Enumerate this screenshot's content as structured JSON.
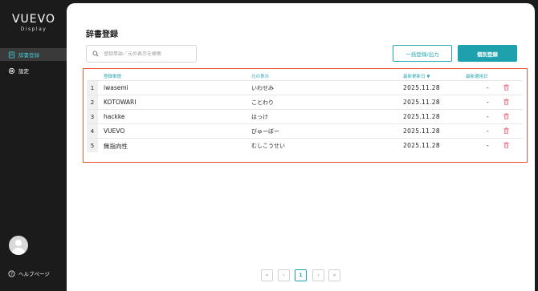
{
  "sidebar": {
    "logo_main": "VUEVO",
    "logo_sub": "Display",
    "items": [
      {
        "label": "辞書登録",
        "icon": "dictionary-icon",
        "active": true
      },
      {
        "label": "設定",
        "icon": "gear-icon",
        "active": false
      }
    ],
    "help_label": "ヘルプページ"
  },
  "header": {
    "title": "辞書登録"
  },
  "toolbar": {
    "search_placeholder": "登録単語／元の表示を検索",
    "bulk_button": "一括登録/出力",
    "single_button": "個別登録"
  },
  "table": {
    "columns": {
      "word": "登録単語",
      "display": "元の表示",
      "updated": "最新更新日 ▼",
      "used": "最新適用日"
    },
    "rows": [
      {
        "num": "1",
        "word": "iwasemi",
        "display": "いわせみ",
        "updated": "2025.11.28",
        "used": "-"
      },
      {
        "num": "2",
        "word": "KOTOWARI",
        "display": "ことわり",
        "updated": "2025.11.28",
        "used": "-"
      },
      {
        "num": "3",
        "word": "hackke",
        "display": "はっけ",
        "updated": "2025.11.28",
        "used": "-"
      },
      {
        "num": "4",
        "word": "VUEVO",
        "display": "びゅーぼー",
        "updated": "2025.11.28",
        "used": "-"
      },
      {
        "num": "5",
        "word": "無指向性",
        "display": "むしこうせい",
        "updated": "2025.11.28",
        "used": "-"
      }
    ]
  },
  "pagination": {
    "first": "«",
    "prev": "‹",
    "current": "1",
    "next": "›",
    "last": "»"
  },
  "colors": {
    "accent": "#1ea1ad",
    "highlight_border": "#ec5a3c",
    "delete_icon": "#e8748a"
  }
}
